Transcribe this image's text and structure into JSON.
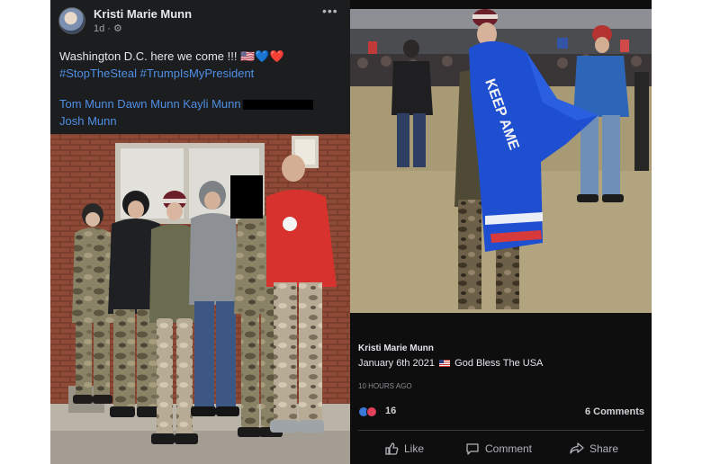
{
  "left_post": {
    "author": "Kristi Marie Munn",
    "meta": "1d · ⚙",
    "more_icon": "more-horizontal-icon",
    "text": "Washington D.C. here we come !!! 🇺🇸💙❤️",
    "hashtags": "#StopTheSteal #TrumpIsMyPresident",
    "tags_line1": "Tom Munn Dawn Munn Kayli Munn",
    "tags_line2": "Josh Munn"
  },
  "right_post": {
    "author": "Kristi Marie Munn",
    "caption_date": "January 6th 2021",
    "caption_text": "God Bless The USA",
    "time": "10 HOURS AGO",
    "reaction_count": "16",
    "comments": "6 Comments",
    "actions": {
      "like": "Like",
      "comment": "Comment",
      "share": "Share"
    },
    "flag_text": "KEEP AME"
  },
  "colors": {
    "link": "#4f8fe6",
    "post_bg_left": "#1c1d1f",
    "post_bg_right": "#0e0e0f",
    "hoodie_red": "#d8322e",
    "flag_blue": "#1f4fd1"
  }
}
